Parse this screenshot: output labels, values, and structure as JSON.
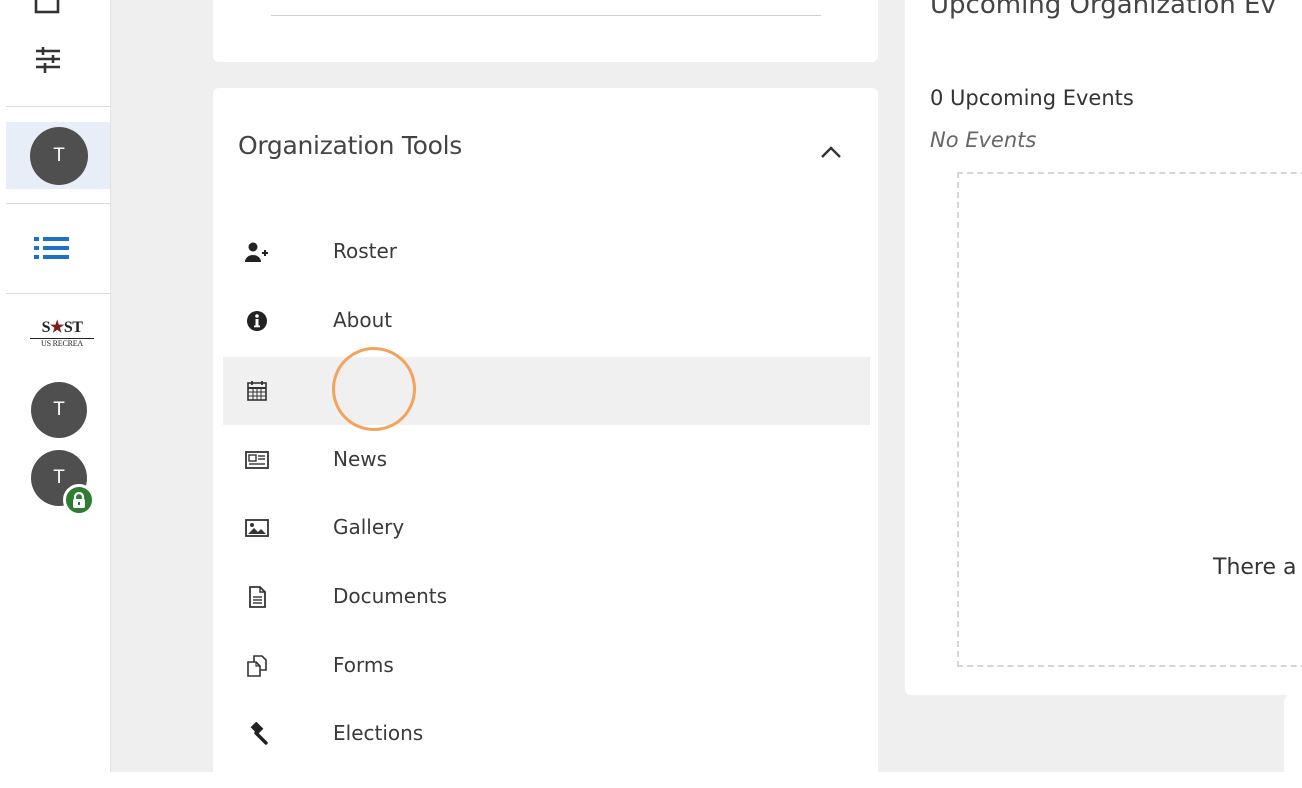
{
  "rail": {
    "avatar_active_initial": "T",
    "logo_top": "S",
    "logo_top_left": "S",
    "logo_top_right": "ST",
    "logo_sub": "US RECREA",
    "avatar_2_initial": "T",
    "avatar_3_initial": "T"
  },
  "tools": {
    "title": "Organization Tools",
    "items": [
      {
        "label": "Roster",
        "icon": "user-plus-icon"
      },
      {
        "label": "About",
        "icon": "info-circle-icon"
      },
      {
        "label": "",
        "icon": "calendar-icon"
      },
      {
        "label": "News",
        "icon": "newspaper-icon"
      },
      {
        "label": "Gallery",
        "icon": "image-icon"
      },
      {
        "label": "Documents",
        "icon": "document-icon"
      },
      {
        "label": "Forms",
        "icon": "forms-icon"
      },
      {
        "label": "Elections",
        "icon": "gavel-icon"
      }
    ]
  },
  "events": {
    "title": "Upcoming Organization Ev",
    "count_label": "0 Upcoming Events",
    "empty_label": "No Events",
    "body_text": "There a"
  },
  "colors": {
    "accent_blue": "#1a73c8",
    "avatar_grey": "#4f4f4f",
    "lock_green": "#2e7d32",
    "cursor_orange": "#f5a25d"
  }
}
